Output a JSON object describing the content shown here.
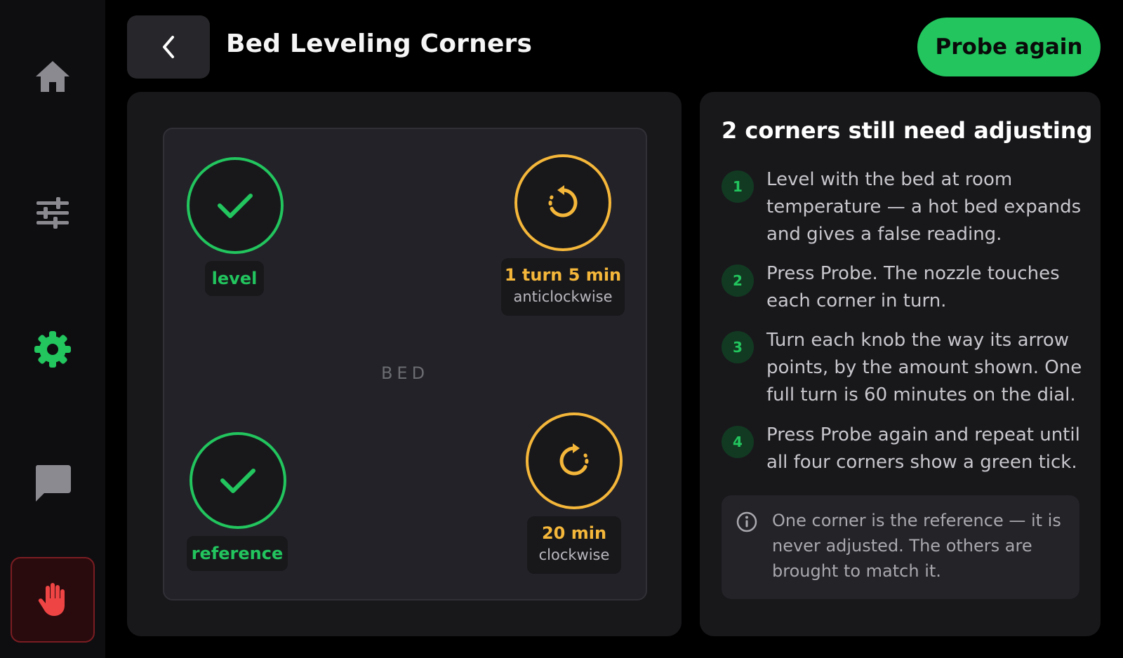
{
  "header": {
    "title": "Bed Leveling Corners",
    "probe_button": "Probe again"
  },
  "sidebar": {
    "items": [
      {
        "icon": "home-icon",
        "active": false
      },
      {
        "icon": "sliders-icon",
        "active": false
      },
      {
        "icon": "gear-icon",
        "active": true
      },
      {
        "icon": "chat-icon",
        "active": false
      }
    ],
    "estop_icon": "hand-stop-icon"
  },
  "bed": {
    "label": "BED",
    "corners": {
      "top_left": {
        "status": "level",
        "label": "level"
      },
      "top_right": {
        "status": "adjust",
        "amount": "1 turn 5 min",
        "direction": "anticlockwise"
      },
      "bottom_left": {
        "status": "reference",
        "label": "reference"
      },
      "bottom_right": {
        "status": "adjust",
        "amount": "20 min",
        "direction": "clockwise"
      }
    }
  },
  "instructions": {
    "title": "2 corners still need adjusting",
    "steps": [
      {
        "num": "1",
        "text": "Level with the bed at room temperature — a hot bed expands and gives a false reading."
      },
      {
        "num": "2",
        "text": "Press Probe. The nozzle touches each corner in turn."
      },
      {
        "num": "3",
        "text": "Turn each knob the way its arrow points, by the amount shown. One full turn is 60 minutes on the dial."
      },
      {
        "num": "4",
        "text": "Press Probe again and repeat until all four corners show a green tick."
      }
    ],
    "info": "One corner is the reference — it is never adjusted. The others are brought to match it."
  },
  "colors": {
    "accent_green": "#22c55e",
    "adjust_amber": "#f5b73a",
    "estop_red": "#ef4444"
  }
}
